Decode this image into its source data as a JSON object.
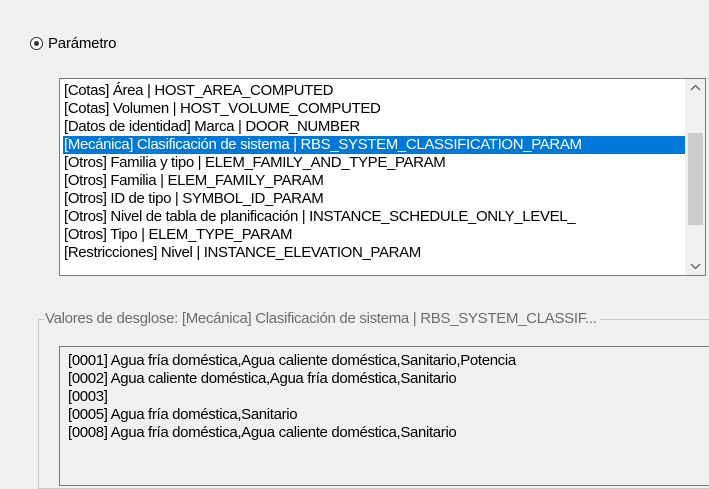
{
  "radio": {
    "label": "Parámetro",
    "checked": true
  },
  "parameter_list": {
    "items": [
      "[Cotas] Área | HOST_AREA_COMPUTED",
      "[Cotas] Volumen | HOST_VOLUME_COMPUTED",
      "[Datos de identidad] Marca | DOOR_NUMBER",
      "[Mecánica] Clasificación de sistema | RBS_SYSTEM_CLASSIFICATION_PARAM",
      "[Otros] Familia y tipo | ELEM_FAMILY_AND_TYPE_PARAM",
      "[Otros] Familia | ELEM_FAMILY_PARAM",
      "[Otros] ID de tipo | SYMBOL_ID_PARAM",
      "[Otros] Nivel de tabla de planificación | INSTANCE_SCHEDULE_ONLY_LEVEL_",
      "[Otros] Tipo | ELEM_TYPE_PARAM",
      "[Restricciones] Nivel | INSTANCE_ELEVATION_PARAM"
    ],
    "selected_index": 3
  },
  "breakdown": {
    "caption": "Valores de desglose: [Mecánica] Clasificación de sistema | RBS_SYSTEM_CLASSIF...",
    "values": [
      "[0001] Agua fría doméstica,Agua caliente doméstica,Sanitario,Potencia",
      "[0002] Agua caliente doméstica,Agua fría doméstica,Sanitario",
      "[0003]",
      "[0005] Agua fría doméstica,Sanitario",
      "[0008] Agua fría doméstica,Agua caliente doméstica,Sanitario"
    ]
  },
  "colors": {
    "selection": "#0078d7",
    "window_bg": "#f0f0f0",
    "scroll_thumb": "#cdcdcd"
  },
  "icons": {
    "scroll_up": "chevron-up-icon",
    "scroll_down": "chevron-down-icon"
  }
}
